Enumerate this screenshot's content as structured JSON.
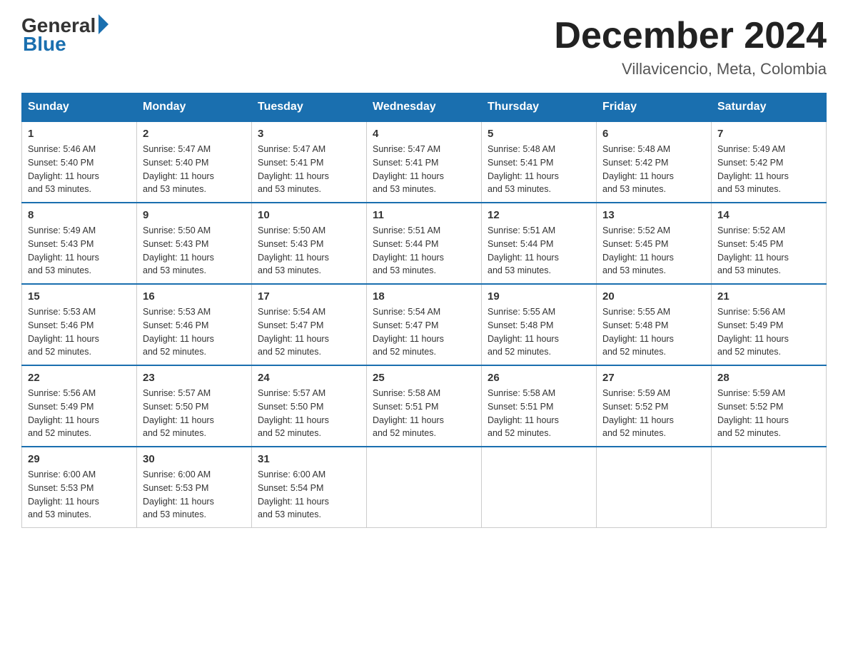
{
  "logo": {
    "general": "General",
    "blue": "Blue"
  },
  "title": "December 2024",
  "location": "Villavicencio, Meta, Colombia",
  "weekdays": [
    "Sunday",
    "Monday",
    "Tuesday",
    "Wednesday",
    "Thursday",
    "Friday",
    "Saturday"
  ],
  "weeks": [
    [
      {
        "day": "1",
        "sunrise": "5:46 AM",
        "sunset": "5:40 PM",
        "daylight": "11 hours and 53 minutes."
      },
      {
        "day": "2",
        "sunrise": "5:47 AM",
        "sunset": "5:40 PM",
        "daylight": "11 hours and 53 minutes."
      },
      {
        "day": "3",
        "sunrise": "5:47 AM",
        "sunset": "5:41 PM",
        "daylight": "11 hours and 53 minutes."
      },
      {
        "day": "4",
        "sunrise": "5:47 AM",
        "sunset": "5:41 PM",
        "daylight": "11 hours and 53 minutes."
      },
      {
        "day": "5",
        "sunrise": "5:48 AM",
        "sunset": "5:41 PM",
        "daylight": "11 hours and 53 minutes."
      },
      {
        "day": "6",
        "sunrise": "5:48 AM",
        "sunset": "5:42 PM",
        "daylight": "11 hours and 53 minutes."
      },
      {
        "day": "7",
        "sunrise": "5:49 AM",
        "sunset": "5:42 PM",
        "daylight": "11 hours and 53 minutes."
      }
    ],
    [
      {
        "day": "8",
        "sunrise": "5:49 AM",
        "sunset": "5:43 PM",
        "daylight": "11 hours and 53 minutes."
      },
      {
        "day": "9",
        "sunrise": "5:50 AM",
        "sunset": "5:43 PM",
        "daylight": "11 hours and 53 minutes."
      },
      {
        "day": "10",
        "sunrise": "5:50 AM",
        "sunset": "5:43 PM",
        "daylight": "11 hours and 53 minutes."
      },
      {
        "day": "11",
        "sunrise": "5:51 AM",
        "sunset": "5:44 PM",
        "daylight": "11 hours and 53 minutes."
      },
      {
        "day": "12",
        "sunrise": "5:51 AM",
        "sunset": "5:44 PM",
        "daylight": "11 hours and 53 minutes."
      },
      {
        "day": "13",
        "sunrise": "5:52 AM",
        "sunset": "5:45 PM",
        "daylight": "11 hours and 53 minutes."
      },
      {
        "day": "14",
        "sunrise": "5:52 AM",
        "sunset": "5:45 PM",
        "daylight": "11 hours and 53 minutes."
      }
    ],
    [
      {
        "day": "15",
        "sunrise": "5:53 AM",
        "sunset": "5:46 PM",
        "daylight": "11 hours and 52 minutes."
      },
      {
        "day": "16",
        "sunrise": "5:53 AM",
        "sunset": "5:46 PM",
        "daylight": "11 hours and 52 minutes."
      },
      {
        "day": "17",
        "sunrise": "5:54 AM",
        "sunset": "5:47 PM",
        "daylight": "11 hours and 52 minutes."
      },
      {
        "day": "18",
        "sunrise": "5:54 AM",
        "sunset": "5:47 PM",
        "daylight": "11 hours and 52 minutes."
      },
      {
        "day": "19",
        "sunrise": "5:55 AM",
        "sunset": "5:48 PM",
        "daylight": "11 hours and 52 minutes."
      },
      {
        "day": "20",
        "sunrise": "5:55 AM",
        "sunset": "5:48 PM",
        "daylight": "11 hours and 52 minutes."
      },
      {
        "day": "21",
        "sunrise": "5:56 AM",
        "sunset": "5:49 PM",
        "daylight": "11 hours and 52 minutes."
      }
    ],
    [
      {
        "day": "22",
        "sunrise": "5:56 AM",
        "sunset": "5:49 PM",
        "daylight": "11 hours and 52 minutes."
      },
      {
        "day": "23",
        "sunrise": "5:57 AM",
        "sunset": "5:50 PM",
        "daylight": "11 hours and 52 minutes."
      },
      {
        "day": "24",
        "sunrise": "5:57 AM",
        "sunset": "5:50 PM",
        "daylight": "11 hours and 52 minutes."
      },
      {
        "day": "25",
        "sunrise": "5:58 AM",
        "sunset": "5:51 PM",
        "daylight": "11 hours and 52 minutes."
      },
      {
        "day": "26",
        "sunrise": "5:58 AM",
        "sunset": "5:51 PM",
        "daylight": "11 hours and 52 minutes."
      },
      {
        "day": "27",
        "sunrise": "5:59 AM",
        "sunset": "5:52 PM",
        "daylight": "11 hours and 52 minutes."
      },
      {
        "day": "28",
        "sunrise": "5:59 AM",
        "sunset": "5:52 PM",
        "daylight": "11 hours and 52 minutes."
      }
    ],
    [
      {
        "day": "29",
        "sunrise": "6:00 AM",
        "sunset": "5:53 PM",
        "daylight": "11 hours and 53 minutes."
      },
      {
        "day": "30",
        "sunrise": "6:00 AM",
        "sunset": "5:53 PM",
        "daylight": "11 hours and 53 minutes."
      },
      {
        "day": "31",
        "sunrise": "6:00 AM",
        "sunset": "5:54 PM",
        "daylight": "11 hours and 53 minutes."
      },
      null,
      null,
      null,
      null
    ]
  ],
  "labels": {
    "sunrise": "Sunrise:",
    "sunset": "Sunset:",
    "daylight": "Daylight:"
  }
}
